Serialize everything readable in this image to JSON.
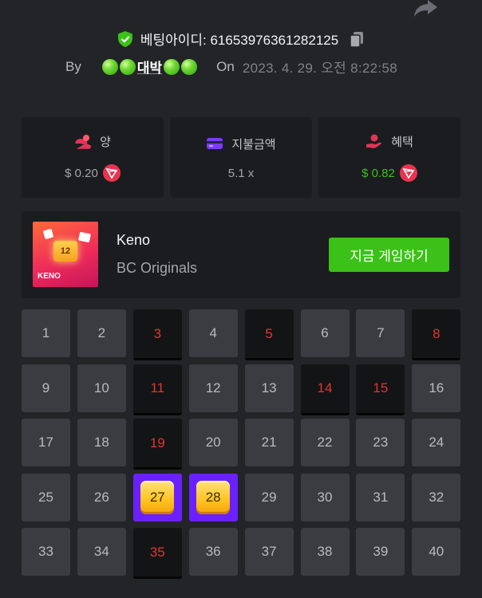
{
  "header": {
    "bet_id_label": "베팅아이디: 61653976361282125",
    "by_label": "By",
    "user_name": "대박",
    "on_label": "On",
    "timestamp": "2023. 4. 29. 오전 8:22:58"
  },
  "stats": [
    {
      "label": "양",
      "value": "$ 0.20",
      "icon": "coin-stack-icon",
      "currency_icon": "trx-icon"
    },
    {
      "label": "지불금액",
      "value": "5.1 x",
      "icon": "wallet-icon"
    },
    {
      "label": "혜택",
      "value": "$ 0.82",
      "icon": "profit-hand-icon",
      "currency_icon": "trx-icon"
    }
  ],
  "game": {
    "name": "Keno",
    "provider": "BC Originals",
    "thumb_number": "12",
    "thumb_label": "KENO",
    "play_label": "지금 게임하기"
  },
  "board": {
    "numbers": [
      "1",
      "2",
      "3",
      "4",
      "5",
      "6",
      "7",
      "8",
      "9",
      "10",
      "11",
      "12",
      "13",
      "14",
      "15",
      "16",
      "17",
      "18",
      "19",
      "20",
      "21",
      "22",
      "23",
      "24",
      "25",
      "26",
      "27",
      "28",
      "29",
      "30",
      "31",
      "32",
      "33",
      "34",
      "35",
      "36",
      "37",
      "38",
      "39",
      "40"
    ],
    "drawn": [
      3,
      5,
      8,
      11,
      14,
      15,
      19,
      35
    ],
    "matched": [
      27,
      28
    ]
  },
  "colors": {
    "accent_green": "#3bc117",
    "hit_red": "#e1362f",
    "gem_purple": "#6b21ff",
    "background": "#232427"
  }
}
